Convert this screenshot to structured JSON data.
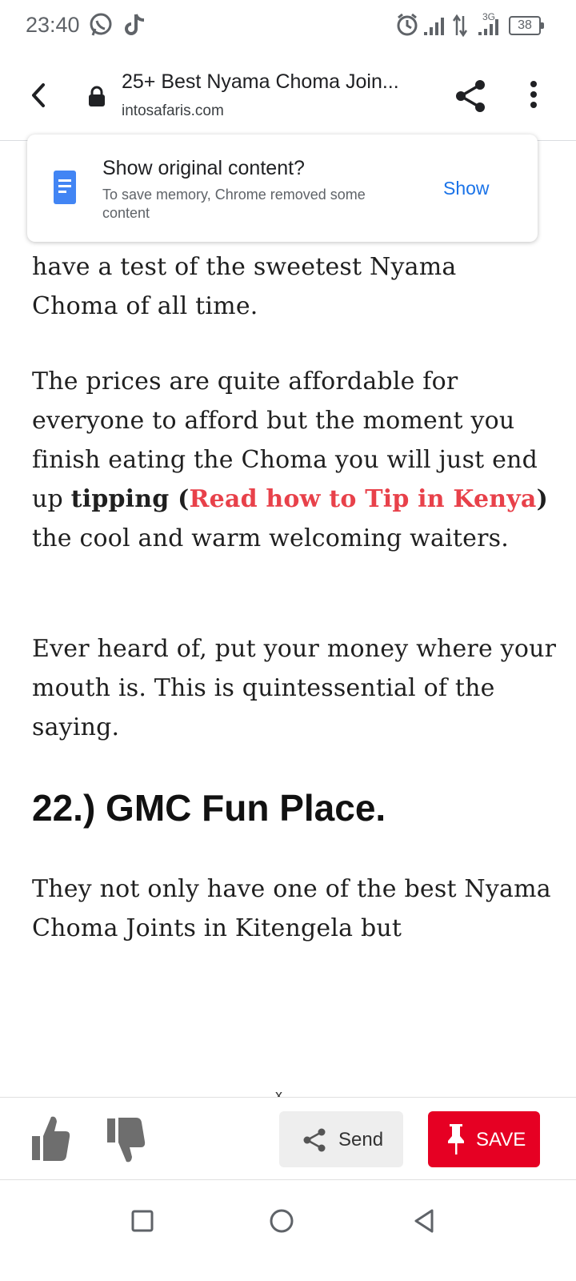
{
  "status_bar": {
    "time": "23:40",
    "network": "3G",
    "battery": "38",
    "icons": [
      "whatsapp-icon",
      "tiktok-icon",
      "alarm-icon",
      "signal-icon",
      "data-arrows-icon",
      "signal-icon",
      "battery-icon"
    ]
  },
  "toolbar": {
    "title": "25+ Best Nyama Choma Join...",
    "url": "intosafaris.com"
  },
  "popup": {
    "title": "Show original content?",
    "body": "To save memory, Chrome removed some content",
    "action": "Show"
  },
  "article": {
    "partial_line": "have a test of the sweetest Nyama Choma of all time.",
    "p2_a": "The prices are quite affordable for everyone to afford but the moment you finish eating the Choma you will just end up ",
    "p2_bold_open": "tipping (",
    "p2_link": "Read how to Tip in Kenya",
    "p2_bold_close": ")",
    "p2_b": " the cool and warm welcoming waiters.",
    "p3": "Ever heard of, put your money where your mouth is. This is quintessential of the saying.",
    "heading": "22.) GMC Fun Place.",
    "p4": "They not only have one of the best Nyama Choma Joints in Kitengela but"
  },
  "action_bar": {
    "close": "x",
    "send": "Send",
    "save": "SAVE"
  },
  "colors": {
    "link": "#e8414a",
    "save": "#e60023",
    "show": "#1a73e8"
  }
}
